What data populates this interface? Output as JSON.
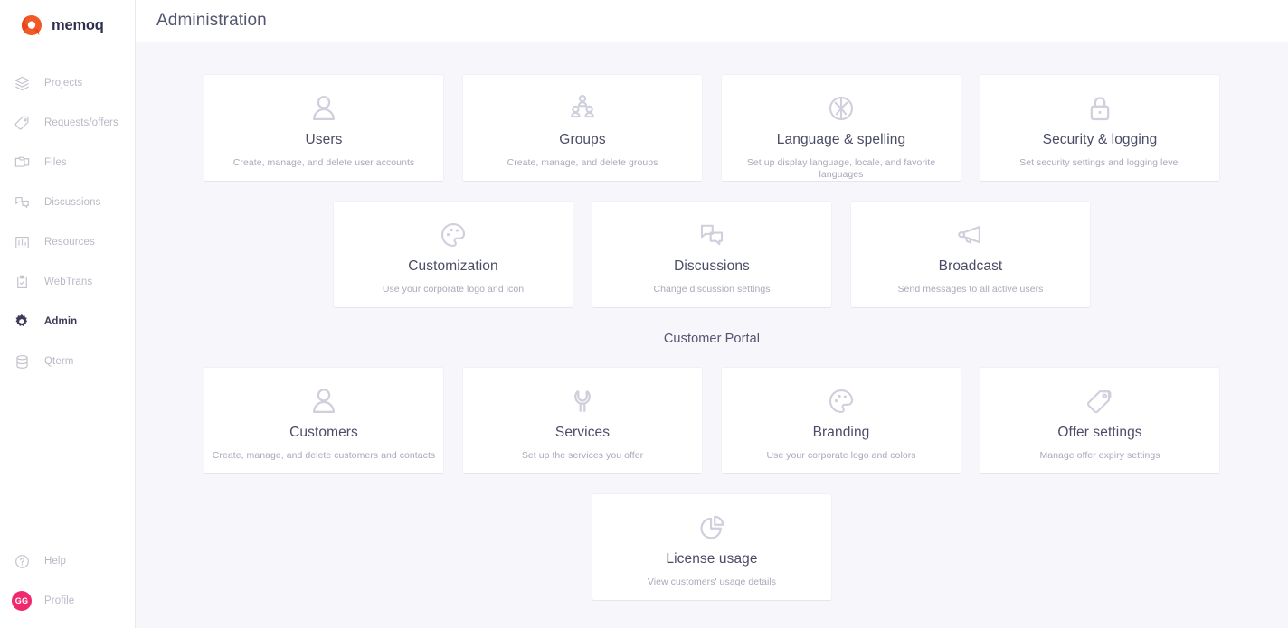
{
  "brand": {
    "name": "memoq",
    "logo_icon": "memoq-logo-icon"
  },
  "sidebar": {
    "items": [
      {
        "label": "Projects",
        "icon": "layers-icon",
        "active": false
      },
      {
        "label": "Requests/offers",
        "icon": "tag-icon",
        "active": false
      },
      {
        "label": "Files",
        "icon": "folder-icon",
        "active": false
      },
      {
        "label": "Discussions",
        "icon": "chat-icon",
        "active": false
      },
      {
        "label": "Resources",
        "icon": "bar-chart-icon",
        "active": false
      },
      {
        "label": "WebTrans",
        "icon": "clipboard-icon",
        "active": false
      },
      {
        "label": "Admin",
        "icon": "gear-icon",
        "active": true
      },
      {
        "label": "Qterm",
        "icon": "database-icon",
        "active": false
      }
    ],
    "bottom_items": [
      {
        "label": "Help",
        "icon": "question-circle-icon"
      },
      {
        "label": "Profile",
        "icon": "avatar",
        "avatar_initials": "GG",
        "avatar_color": "#f0296e"
      }
    ]
  },
  "header": {
    "title": "Administration"
  },
  "sections": {
    "admin_row1": [
      {
        "title": "Users",
        "desc": "Create, manage, and delete user accounts",
        "icon": "user-icon"
      },
      {
        "title": "Groups",
        "desc": "Create, manage, and delete groups",
        "icon": "users-group-icon"
      },
      {
        "title": "Language & spelling",
        "desc": "Set up display language, locale, and favorite languages",
        "icon": "globe-icon"
      },
      {
        "title": "Security & logging",
        "desc": "Set security settings and logging level",
        "icon": "lock-icon"
      }
    ],
    "admin_row2": [
      {
        "title": "Customization",
        "desc": "Use your corporate logo and icon",
        "icon": "palette-icon"
      },
      {
        "title": "Discussions",
        "desc": "Change discussion settings",
        "icon": "chat-bubbles-icon"
      },
      {
        "title": "Broadcast",
        "desc": "Send messages to all active users",
        "icon": "megaphone-icon"
      }
    ],
    "customer_portal_title": "Customer Portal",
    "portal_row1": [
      {
        "title": "Customers",
        "desc": "Create, manage, and delete customers and contacts",
        "icon": "user-icon"
      },
      {
        "title": "Services",
        "desc": "Set up the services you offer",
        "icon": "wrench-icon"
      },
      {
        "title": "Branding",
        "desc": "Use your corporate logo and colors",
        "icon": "palette-icon"
      },
      {
        "title": "Offer settings",
        "desc": "Manage offer expiry settings",
        "icon": "tags-icon"
      }
    ],
    "portal_row2": [
      {
        "title": "License usage",
        "desc": "View customers' usage details",
        "icon": "pie-chart-icon"
      }
    ]
  },
  "colors": {
    "background": "#f7f6fb",
    "card": "#ffffff",
    "brand_orange": "#f05a28",
    "brand_navy": "#2f3050",
    "accent_pink": "#f0296e",
    "icon_muted": "#cfcfdd",
    "title_text": "#4b4c66",
    "desc_text": "#a9a9b9"
  }
}
